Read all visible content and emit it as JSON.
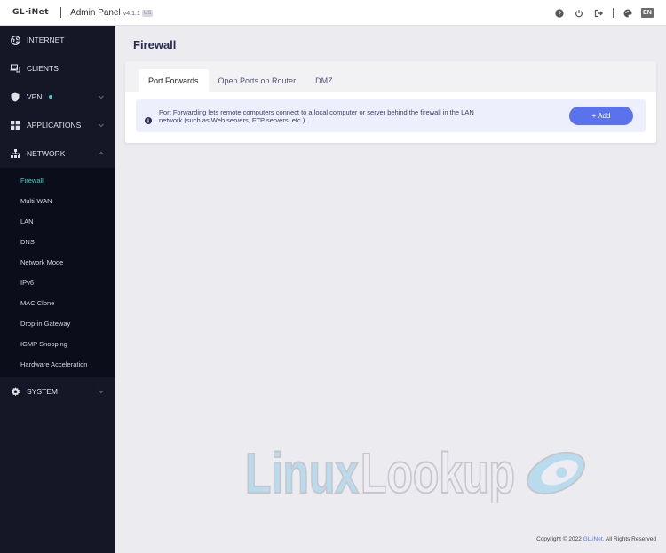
{
  "topbar": {
    "logo": "GL·iNet",
    "title": "Admin Panel",
    "version": "v4.1.1",
    "region": "US",
    "icons": [
      "help-icon",
      "power-icon",
      "logout-icon",
      "theme-palette-icon"
    ],
    "language": "EN"
  },
  "sidebar": {
    "items": [
      {
        "label": "INTERNET",
        "icon": "globe-icon"
      },
      {
        "label": "CLIENTS",
        "icon": "devices-icon"
      },
      {
        "label": "VPN",
        "icon": "shield-icon",
        "status_dot_color": "#3ad1c6"
      },
      {
        "label": "APPLICATIONS",
        "icon": "apps-grid-icon"
      },
      {
        "label": "NETWORK",
        "icon": "network-tree-icon"
      },
      {
        "label": "SYSTEM",
        "icon": "gear-icon"
      }
    ],
    "network_submenu": [
      {
        "label": "Firewall",
        "active": true
      },
      {
        "label": "Multi-WAN"
      },
      {
        "label": "LAN"
      },
      {
        "label": "DNS"
      },
      {
        "label": "Network Mode"
      },
      {
        "label": "IPv6"
      },
      {
        "label": "MAC Clone"
      },
      {
        "label": "Drop-in Gateway"
      },
      {
        "label": "IGMP Snooping"
      },
      {
        "label": "Hardware Acceleration"
      }
    ]
  },
  "main": {
    "title": "Firewall",
    "tabs": [
      {
        "label": "Port Forwards",
        "active": true
      },
      {
        "label": "Open Ports on Router"
      },
      {
        "label": "DMZ"
      }
    ],
    "info_text": "Port Forwarding lets remote computers connect to a local computer or server behind the firewall in the LAN network (such as Web servers, FTP servers, etc.).",
    "add_button": "+ Add"
  },
  "watermark": {
    "part1": "Linux",
    "part2": "Lookup"
  },
  "footer": {
    "prefix": "Copyright © 2022 ",
    "link": "GL.iNet.",
    "suffix": " All Rights Reserved"
  },
  "colors": {
    "accent": "#5a73ec",
    "sidebar_bg": "#151626",
    "active_submenu": "#3ad1c6",
    "title": "#2b2c55"
  }
}
